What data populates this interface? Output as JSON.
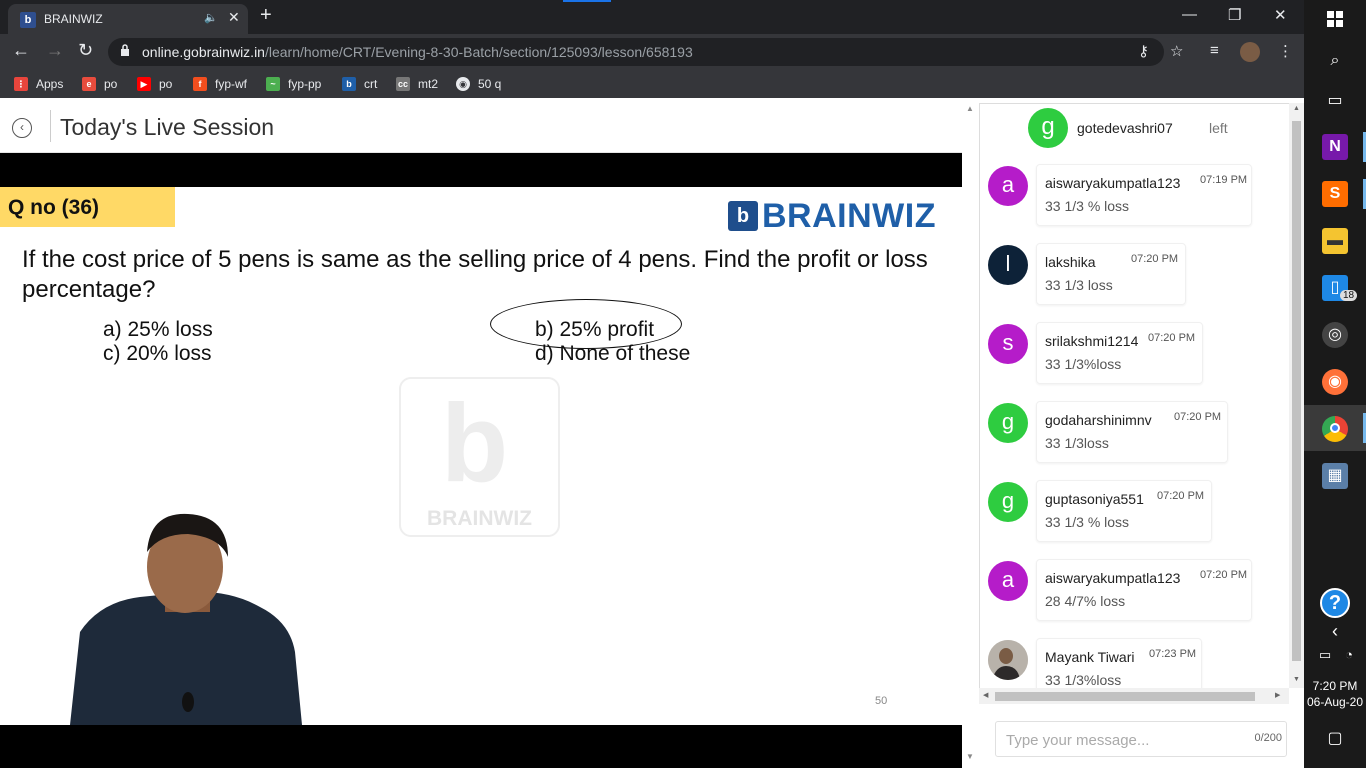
{
  "browser": {
    "tab_title": "BRAINWIZ",
    "url_host": "online.gobrainwiz.in",
    "url_path": "/learn/home/CRT/Evening-8-30-Batch/section/125093/lesson/658193"
  },
  "bookmarks": [
    {
      "label": "Apps",
      "icon": "apps-grid-icon",
      "color": "#e8453c"
    },
    {
      "label": "po",
      "icon": "po-icon",
      "color": "#e84c3d"
    },
    {
      "label": "po",
      "icon": "youtube-icon",
      "color": "#ff0000"
    },
    {
      "label": "fyp-wf",
      "icon": "figma-icon",
      "color": "#f24e1e"
    },
    {
      "label": "fyp-pp",
      "icon": "chart-icon",
      "color": "#4caf50"
    },
    {
      "label": "crt",
      "icon": "brainwiz-icon",
      "color": "#1f5fa8"
    },
    {
      "label": "mt2",
      "icon": "cc-icon",
      "color": "#777777"
    },
    {
      "label": "50 q",
      "icon": "globe-icon",
      "color": "#e8eaed"
    }
  ],
  "lesson": {
    "title": "Today's Live Session"
  },
  "slide": {
    "qno": "Q no (36)",
    "brand": "BRAINWIZ",
    "question": "If the cost price of 5 pens is same as the selling price of 4 pens. Find the profit or loss percentage?",
    "options": {
      "a": "a)   25% loss",
      "b": "b) 25% profit",
      "c": "c)   20% loss",
      "d": "d) None of these"
    },
    "watermark": "BRAINWIZ",
    "page_number": "50"
  },
  "chat": {
    "left_notice": {
      "initial": "g",
      "name": "gotedevashri07",
      "status": "left"
    },
    "messages": [
      {
        "initial": "a",
        "color": "#b51cc9",
        "name": "aiswaryakumpatla123",
        "time": "07:19 PM",
        "text": "33 1/3 % loss"
      },
      {
        "initial": "l",
        "color": "#0d2238",
        "name": "lakshika",
        "time": "07:20 PM",
        "text": "33 1/3 loss"
      },
      {
        "initial": "s",
        "color": "#b51cc9",
        "name": "srilakshmi1214",
        "time": "07:20 PM",
        "text": "33 1/3%loss"
      },
      {
        "initial": "g",
        "color": "#2ecc40",
        "name": "godaharshinimnv",
        "time": "07:20 PM",
        "text": "33 1/3loss"
      },
      {
        "initial": "g",
        "color": "#2ecc40",
        "name": "guptasoniya551",
        "time": "07:20 PM",
        "text": "33 1/3 % loss"
      },
      {
        "initial": "a",
        "color": "#b51cc9",
        "name": "aiswaryakumpatla123",
        "time": "07:20 PM",
        "text": "28 4/7% loss"
      },
      {
        "initial": "",
        "color": "#6b5a50",
        "name": "Mayank Tiwari",
        "time": "07:23 PM",
        "text": "33 1/3%loss"
      }
    ],
    "input_placeholder": "Type your message...",
    "char_count": "0/200"
  },
  "taskbar": {
    "time": "7:20 PM",
    "date": "06-Aug-20",
    "badge": "18"
  }
}
